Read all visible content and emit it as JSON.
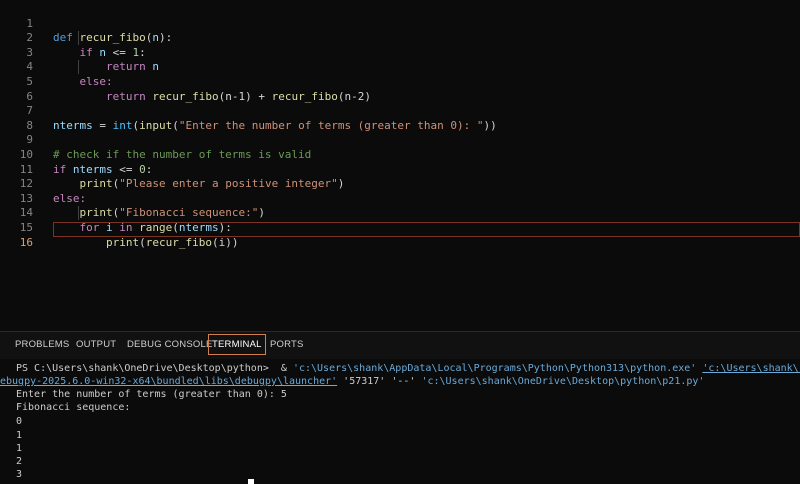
{
  "editor": {
    "line_numbers": [
      "1",
      "2",
      "3",
      "4",
      "5",
      "6",
      "7",
      "8",
      "9",
      "10",
      "11",
      "12",
      "13",
      "14",
      "15",
      "16"
    ],
    "tokens": {
      "l1_def": "def",
      "l1_fn": "recur_fibo",
      "l1_open": "(",
      "l1_arg": "n",
      "l1_close": "):",
      "l2_if": "if",
      "l2_n": "n",
      "l2_op": " <= ",
      "l2_num": "1",
      "l2_colon": ":",
      "l3_return": "return",
      "l3_n": "n",
      "l4_else": "else:",
      "l5_return": "return",
      "l5_fn1": "recur_fibo",
      "l5_arg1": "(n-1)",
      "l5_plus": " + ",
      "l5_fn2": "recur_fibo",
      "l5_arg2": "(n-2)",
      "l7_var": "nterms",
      "l7_eq": " = ",
      "l7_int": "int",
      "l7_p1": "(",
      "l7_input": "input",
      "l7_p2": "(",
      "l7_str": "\"Enter the number of terms (greater than 0): \"",
      "l7_close": "))",
      "l9_comment": "# check if the number of terms is valid",
      "l10_if": "if",
      "l10_var": "nterms",
      "l10_op": " <= ",
      "l10_num": "0",
      "l10_colon": ":",
      "l11_print": "print",
      "l11_p": "(",
      "l11_str": "\"Please enter a positive integer\"",
      "l11_close": ")",
      "l12_else": "else:",
      "l13_print": "print",
      "l13_p": "(",
      "l13_str": "\"Fibonacci sequence:\"",
      "l13_close": ")",
      "l14_for": "for",
      "l14_i": "i",
      "l14_in": "in",
      "l14_range": "range",
      "l14_p": "(",
      "l14_var": "nterms",
      "l14_close": "):",
      "l15_print": "print",
      "l15_p": "(",
      "l15_fn": "recur_fibo",
      "l15_arg": "(i)",
      "l15_close": ")"
    }
  },
  "panel": {
    "tabs": [
      "PROBLEMS",
      "OUTPUT",
      "DEBUG CONSOLE",
      "TERMINAL",
      "PORTS"
    ],
    "active_tab": "TERMINAL"
  },
  "terminal": {
    "prompt": "PS C:\\Users\\shank\\OneDrive\\Desktop\\python>  & ",
    "cmd_python": "'c:\\Users\\shank\\AppData\\Local\\Programs\\Python\\Python313\\python.exe'",
    "cmd_space": " ",
    "cmd_launcher_a": "'c:\\Users\\shank\\.vscode\\extensi",
    "cmd_launcher_b": "ebugpy-2025.6.0-win32-x64\\bundled\\libs\\debugpy\\launcher'",
    "cmd_port": " '57317' '--' ",
    "cmd_file": "'c:\\Users\\shank\\OneDrive\\Desktop\\python\\p21.py'",
    "output": [
      "Enter the number of terms (greater than 0): 5",
      "Fibonacci sequence:",
      "0",
      "1",
      "1",
      "2",
      "3"
    ]
  },
  "colors": {
    "keyword": "#569cd6",
    "control": "#c586c0",
    "function": "#dcdcaa",
    "variable": "#9cdcfe",
    "string": "#ce9178",
    "number": "#b5cea8",
    "comment": "#6a9955",
    "active_tab_border": "#d08050"
  }
}
